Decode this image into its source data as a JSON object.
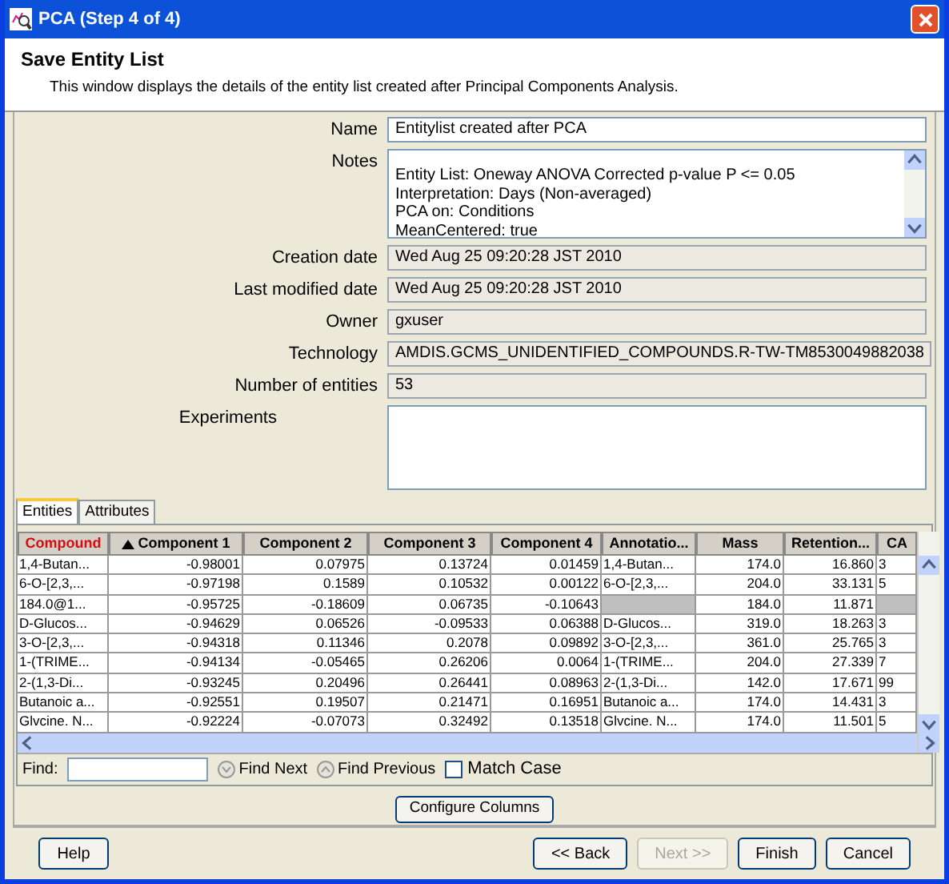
{
  "window": {
    "title": "PCA (Step 4 of 4)"
  },
  "header": {
    "title": "Save Entity List",
    "description": "This window displays the details of the entity list created after Principal Components Analysis."
  },
  "form": [
    {
      "kind": "input",
      "label": "Name",
      "value": "Entitylist created after PCA",
      "editable": true
    },
    {
      "kind": "notes",
      "label": "Notes",
      "lines": [
        "Entity List: Oneway ANOVA Corrected p-value P <= 0.05",
        "Interpretation: Days (Non-averaged)",
        "PCA on: Conditions",
        "MeanCentered: true"
      ]
    },
    {
      "kind": "input",
      "label": "Creation date",
      "value": "Wed Aug 25 09:20:28 JST 2010",
      "editable": false
    },
    {
      "kind": "input",
      "label": "Last modified date",
      "value": "Wed Aug 25 09:20:28 JST 2010",
      "editable": false
    },
    {
      "kind": "input",
      "label": "Owner",
      "value": "gxuser",
      "editable": false
    },
    {
      "kind": "input",
      "label": "Technology",
      "value": "AMDIS.GCMS_UNIDENTIFIED_COMPOUNDS.R-TW-TM8530049882038",
      "editable": false
    },
    {
      "kind": "input",
      "label": "Number of entities",
      "value": "53",
      "editable": false
    },
    {
      "kind": "area",
      "label": "Experiments"
    }
  ],
  "tabs": [
    {
      "label": "Entities",
      "selected": true
    },
    {
      "label": "Attributes",
      "selected": false
    }
  ],
  "table": {
    "columns": [
      {
        "label": "Compound",
        "kind": "text",
        "key": true,
        "sorted": false
      },
      {
        "label": "Component 1",
        "kind": "number",
        "key": false,
        "sorted": true
      },
      {
        "label": "Component 2",
        "kind": "number",
        "key": false,
        "sorted": false
      },
      {
        "label": "Component 3",
        "kind": "number",
        "key": false,
        "sorted": false
      },
      {
        "label": "Component 4",
        "kind": "number",
        "key": false,
        "sorted": false
      },
      {
        "label": "Annotatio...",
        "kind": "text",
        "key": false,
        "sorted": false
      },
      {
        "label": "Mass",
        "kind": "number",
        "key": false,
        "sorted": false
      },
      {
        "label": "Retention...",
        "kind": "number",
        "key": false,
        "sorted": false
      },
      {
        "label": "CA",
        "kind": "text",
        "key": false,
        "sorted": false
      }
    ],
    "rows": [
      [
        "1,4-Butan...",
        "-0.98001",
        "0.07975",
        "0.13724",
        "0.01459",
        "1,4-Butan...",
        "174.0",
        "16.860",
        "3"
      ],
      [
        "6-O-[2,3,...",
        "-0.97198",
        "0.1589",
        "0.10532",
        "0.00122",
        "6-O-[2,3,...",
        "204.0",
        "33.131",
        "5"
      ],
      [
        "184.0@1...",
        "-0.95725",
        "-0.18609",
        "0.06735",
        "-0.10643",
        null,
        "184.0",
        "11.871",
        null
      ],
      [
        "D-Glucos...",
        "-0.94629",
        "0.06526",
        "-0.09533",
        "0.06388",
        "D-Glucos...",
        "319.0",
        "18.263",
        "3"
      ],
      [
        "3-O-[2,3,...",
        "-0.94318",
        "0.11346",
        "0.2078",
        "0.09892",
        "3-O-[2,3,...",
        "361.0",
        "25.765",
        "3"
      ],
      [
        "1-(TRIME...",
        "-0.94134",
        "-0.05465",
        "0.26206",
        "0.0064",
        "1-(TRIME...",
        "204.0",
        "27.339",
        "7"
      ],
      [
        "2-(1,3-Di...",
        "-0.93245",
        "0.20496",
        "0.26441",
        "0.08963",
        "2-(1,3-Di...",
        "142.0",
        "17.671",
        "99"
      ],
      [
        "Butanoic a...",
        "-0.92551",
        "0.19507",
        "0.21471",
        "0.16951",
        "Butanoic a...",
        "174.0",
        "14.431",
        "3"
      ],
      [
        "Glvcine. N...",
        "-0.92224",
        "-0.07073",
        "0.32492",
        "0.13518",
        "Glvcine. N...",
        "174.0",
        "11.501",
        "5"
      ]
    ]
  },
  "find": {
    "label": "Find:",
    "next": "Find Next",
    "previous": "Find Previous",
    "match_case": {
      "label": "Match Case",
      "checked": false
    }
  },
  "configure_button": "Configure Columns",
  "buttons": [
    {
      "label": "Help",
      "disabled": false
    },
    {
      "label": "<< Back",
      "disabled": false
    },
    {
      "label": "Next >>",
      "disabled": true
    },
    {
      "label": "Finish",
      "disabled": false
    },
    {
      "label": "Cancel",
      "disabled": false
    }
  ]
}
